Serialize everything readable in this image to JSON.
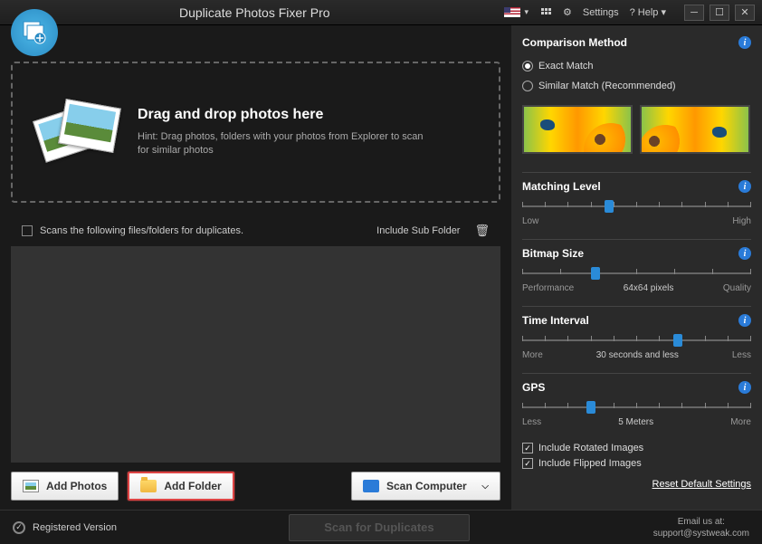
{
  "title": "Duplicate Photos Fixer Pro",
  "titlebar": {
    "settings": "Settings",
    "help": "? Help"
  },
  "dropzone": {
    "heading": "Drag and drop photos here",
    "hint": "Hint: Drag photos, folders with your photos from Explorer to scan for similar photos"
  },
  "list": {
    "header": "Scans the following files/folders for duplicates.",
    "include_sub": "Include Sub Folder"
  },
  "buttons": {
    "add_photos": "Add Photos",
    "add_folder": "Add Folder",
    "scan_computer": "Scan Computer"
  },
  "comparison": {
    "title": "Comparison Method",
    "exact": "Exact Match",
    "similar": "Similar Match (Recommended)"
  },
  "matching_level": {
    "title": "Matching Level",
    "low": "Low",
    "high": "High",
    "thumb_pct": 38
  },
  "bitmap_size": {
    "title": "Bitmap Size",
    "left": "Performance",
    "value": "64x64 pixels",
    "right": "Quality",
    "thumb_pct": 32
  },
  "time_interval": {
    "title": "Time Interval",
    "left": "More",
    "value": "30 seconds and less",
    "right": "Less",
    "thumb_pct": 68
  },
  "gps": {
    "title": "GPS",
    "left": "Less",
    "value": "5 Meters",
    "right": "More",
    "thumb_pct": 30
  },
  "options": {
    "rotated": "Include Rotated Images",
    "flipped": "Include Flipped Images"
  },
  "reset": "Reset Default Settings",
  "footer": {
    "registered": "Registered Version",
    "scan": "Scan for Duplicates",
    "email_label": "Email us at:",
    "email": "support@systweak.com"
  }
}
